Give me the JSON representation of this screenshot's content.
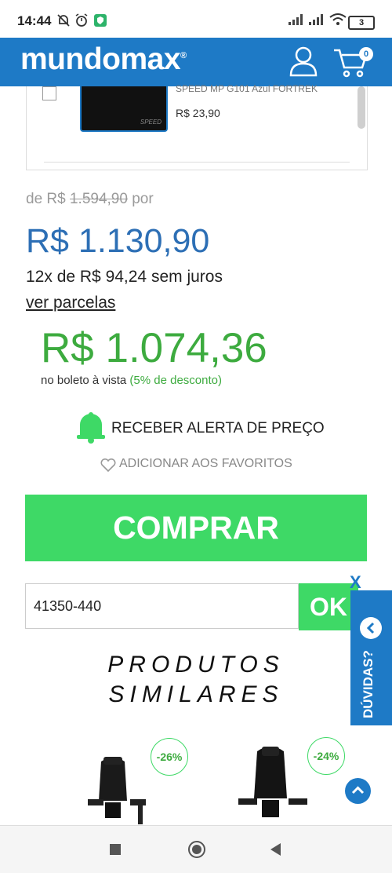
{
  "status_bar": {
    "time": "14:44",
    "battery": "3"
  },
  "header": {
    "logo": "mundomax",
    "cart_count": "0"
  },
  "card": {
    "truncated_title": "SPEED MP G101 Azul FORTREK",
    "price": "R$ 23,90",
    "thumb_brand": "SPEED"
  },
  "pricing": {
    "old_prefix": "de R$",
    "old_value": "1.594,90",
    "old_suffix": "por",
    "main_price": "R$ 1.130,90",
    "installments": "12x de R$ 94,24 sem juros",
    "ver_parcelas": "ver parcelas",
    "boleto_price": "R$ 1.074,36",
    "boleto_text": "no boleto à vista",
    "boleto_discount": "(5% de desconto)"
  },
  "actions": {
    "price_alert": "RECEBER ALERTA DE PREÇO",
    "favorites": "ADICIONAR AOS FAVORITOS",
    "buy": "COMPRAR"
  },
  "cep": {
    "value": "41350-440",
    "ok": "OK",
    "close": "X"
  },
  "help": {
    "label": "DÚVIDAS?"
  },
  "similares": {
    "line1": "PRODUTOS",
    "line2": "SIMILARES"
  },
  "products": [
    {
      "discount": "-26%"
    },
    {
      "discount": "-24%"
    }
  ],
  "colors": {
    "brand_blue": "#1e7ac6",
    "green": "#3ed966",
    "price_blue": "#2d6fb5"
  }
}
